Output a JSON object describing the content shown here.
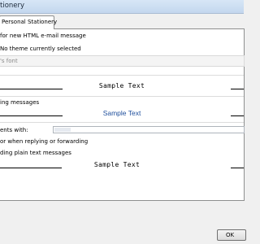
{
  "window": {
    "title": "tionery"
  },
  "tabs": [
    {
      "label": "Personal Stationery"
    }
  ],
  "theme": {
    "heading": "for new HTML e-mail message",
    "status": "No theme currently selected"
  },
  "fonts": {
    "font_placeholder": "'s font",
    "new_mail_sample": "Sample Text",
    "replying_heading": "ing messages",
    "replying_sample": "Sample Text",
    "compose_label": "ents with:",
    "forward_label": "or when replying or forwarding",
    "plain_heading": "ding plain text messages",
    "plain_sample": "Sample Text"
  },
  "buttons": {
    "ok": "OK"
  },
  "colors": {
    "accent_text": "#1f4f9c",
    "title_bar": "#c3d7ee"
  }
}
